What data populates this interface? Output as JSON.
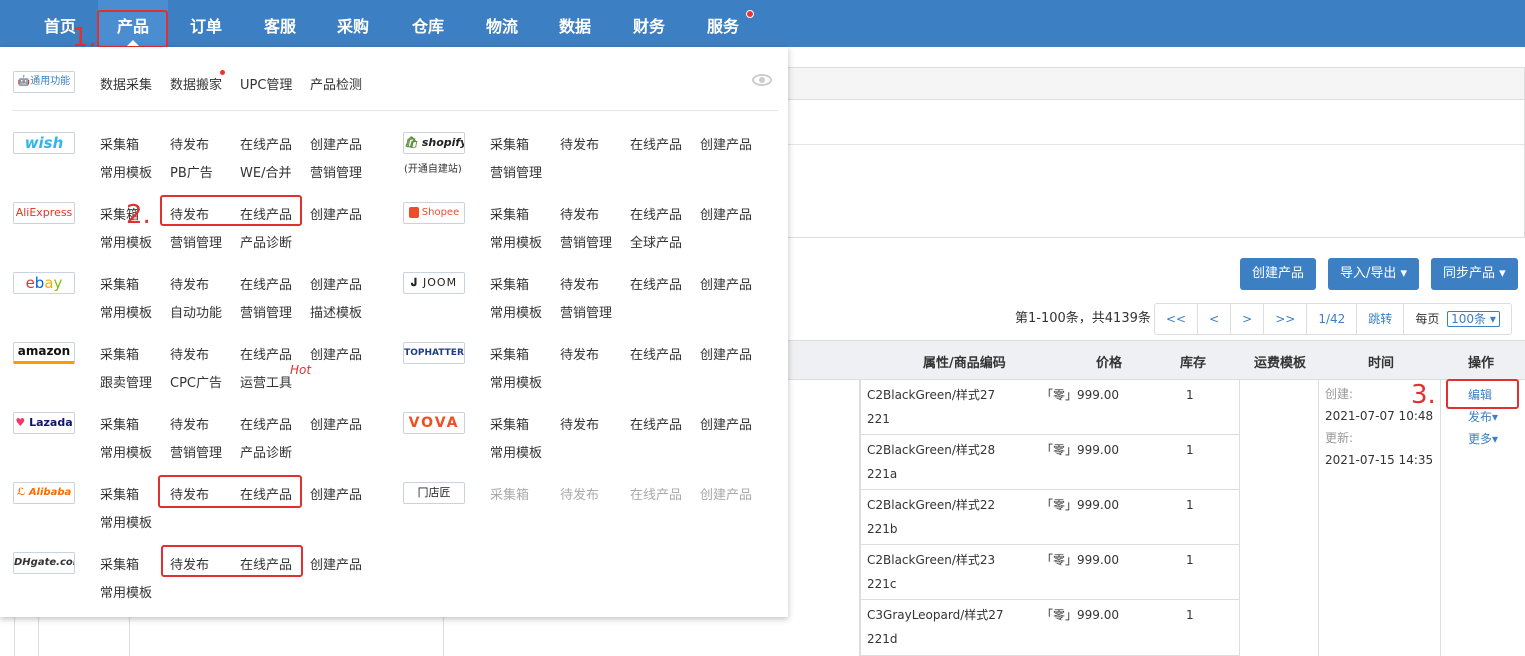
{
  "nav": {
    "items": [
      "首页",
      "产品",
      "订单",
      "客服",
      "采购",
      "仓库",
      "物流",
      "数据",
      "财务",
      "服务"
    ],
    "active": "产品"
  },
  "steps": {
    "one": "1.",
    "two": "2.",
    "three": "3."
  },
  "toolbar": {
    "create": "创建产品",
    "import_export": "导入/导出 ▾",
    "sync": "同步产品 ▾"
  },
  "pager": {
    "summary": "第1-100条，共4139条",
    "first": "<<",
    "prev": "<",
    "next": ">",
    "last": ">>",
    "page": "1/42",
    "jump": "跳转",
    "per_page_label": "每页",
    "per_page_value": "100条 ▾"
  },
  "table": {
    "headers": [
      "属性/商品编码",
      "价格",
      "库存",
      "运费模板",
      "时间",
      "操作"
    ],
    "rows": [
      {
        "code1": "C2BlackGreen/样式27",
        "code2": "221",
        "price": "「零」999.00",
        "stock": "1"
      },
      {
        "code1": "C2BlackGreen/样式28",
        "code2": "221a",
        "price": "「零」999.00",
        "stock": "1"
      },
      {
        "code1": "C2BlackGreen/样式22",
        "code2": "221b",
        "price": "「零」999.00",
        "stock": "1"
      },
      {
        "code1": "C2BlackGreen/样式23",
        "code2": "221c",
        "price": "「零」999.00",
        "stock": "1"
      },
      {
        "code1": "C3GrayLeopard/样式27",
        "code2": "221d",
        "price": "「零」999.00",
        "stock": "1"
      }
    ],
    "time": {
      "created_label": "创建:",
      "created": "2021-07-07 10:48",
      "updated_label": "更新:",
      "updated": "2021-07-15 14:35"
    },
    "actions": {
      "edit": "编辑",
      "publish": "发布▾",
      "more": "更多▾"
    }
  },
  "menu": {
    "general": {
      "logo": "通用功能",
      "items": [
        "数据采集",
        "数据搬家",
        "UPC管理",
        "产品检测"
      ]
    },
    "wish": {
      "logo": "wish",
      "row1": [
        "采集箱",
        "待发布",
        "在线产品",
        "创建产品"
      ],
      "row2": [
        "常用模板",
        "PB广告",
        "WE/合并",
        "营销管理"
      ]
    },
    "shopify": {
      "logo": "shopify",
      "sub": "(开通自建站)",
      "row1": [
        "采集箱",
        "待发布",
        "在线产品",
        "创建产品"
      ],
      "row2": [
        "营销管理"
      ]
    },
    "aliexpress": {
      "logo": "AliExpress",
      "row1": [
        "采集箱",
        "待发布",
        "在线产品",
        "创建产品"
      ],
      "row2": [
        "常用模板",
        "营销管理",
        "产品诊断"
      ]
    },
    "shopee": {
      "logo": "Shopee",
      "row1": [
        "采集箱",
        "待发布",
        "在线产品",
        "创建产品"
      ],
      "row2": [
        "常用模板",
        "营销管理",
        "全球产品"
      ]
    },
    "ebay": {
      "logo": "ebay",
      "row1": [
        "采集箱",
        "待发布",
        "在线产品",
        "创建产品"
      ],
      "row2": [
        "常用模板",
        "自动功能",
        "营销管理",
        "描述模板"
      ]
    },
    "joom": {
      "logo": "JOOM",
      "row1": [
        "采集箱",
        "待发布",
        "在线产品",
        "创建产品"
      ],
      "row2": [
        "常用模板",
        "营销管理"
      ]
    },
    "amazon": {
      "logo": "amazon",
      "row1": [
        "采集箱",
        "待发布",
        "在线产品",
        "创建产品"
      ],
      "row2": [
        "跟卖管理",
        "CPC广告",
        "运营工具"
      ],
      "hot": "Hot"
    },
    "tophatter": {
      "logo": "TOPHATTER",
      "row1": [
        "采集箱",
        "待发布",
        "在线产品",
        "创建产品"
      ],
      "row2": [
        "常用模板"
      ]
    },
    "lazada": {
      "logo": "Lazada",
      "row1": [
        "采集箱",
        "待发布",
        "在线产品",
        "创建产品"
      ],
      "row2": [
        "常用模板",
        "营销管理",
        "产品诊断"
      ]
    },
    "vova": {
      "logo": "VOVA",
      "row1": [
        "采集箱",
        "待发布",
        "在线产品",
        "创建产品"
      ],
      "row2": [
        "常用模板"
      ]
    },
    "alibaba": {
      "logo": "Alibaba",
      "row1": [
        "采集箱",
        "待发布",
        "在线产品",
        "创建产品"
      ],
      "row2": [
        "常用模板"
      ]
    },
    "dianjiang": {
      "logo": "店匠",
      "row1": [
        "采集箱",
        "待发布",
        "在线产品",
        "创建产品"
      ]
    },
    "dhgate": {
      "logo": "DHgate.com",
      "row1": [
        "采集箱",
        "待发布",
        "在线产品",
        "创建产品"
      ],
      "row2": [
        "常用模板"
      ]
    }
  },
  "colors": {
    "nav_bg": "#3d7fc3",
    "accent": "#3d7fc3",
    "highlight": "#e03030"
  }
}
